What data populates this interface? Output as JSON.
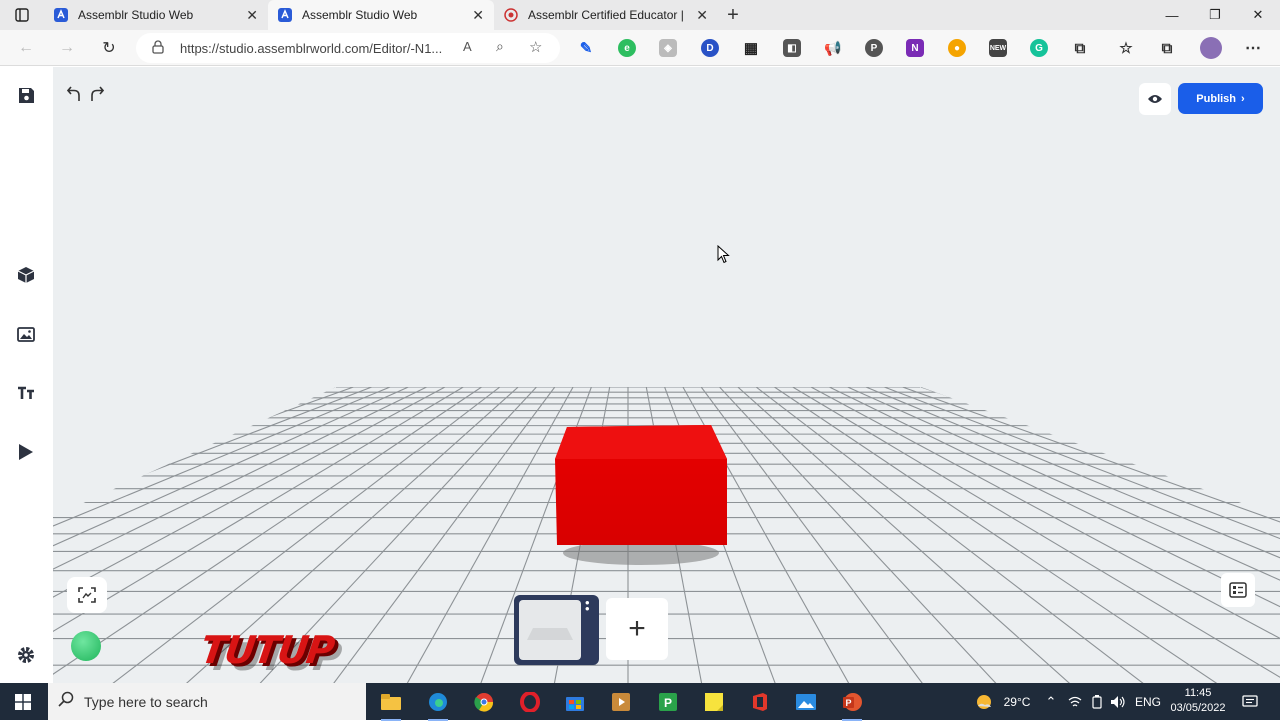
{
  "browser": {
    "tabs": [
      {
        "title": "Assemblr Studio Web",
        "active": false
      },
      {
        "title": "Assemblr Studio Web",
        "active": true
      },
      {
        "title": "Assemblr Certified Educator |",
        "active": false
      }
    ],
    "url": "https://studio.assemblrworld.com/Editor/-N1...",
    "extensions": [
      "edit-ext-icon",
      "evernote-icon",
      "extension-icon",
      "d-ext-icon",
      "grid-ext-icon",
      "ext-icon",
      "megaphone-ext-icon",
      "pinterest-icon",
      "onenote-icon",
      "ext-icon",
      "new-ext-icon",
      "grammarly-icon",
      "extensions-puzzle-icon",
      "favorites-icon",
      "collections-icon",
      "profile-avatar",
      "more-icon"
    ]
  },
  "editor": {
    "publish_label": "Publish",
    "watermark": "TUTUP",
    "object_color": "#e60000",
    "accent": "#1a5ee9"
  },
  "taskbar": {
    "search_placeholder": "Type here to search",
    "temperature": "29°C",
    "language": "ENG",
    "time": "11:45",
    "date": "03/05/2022"
  }
}
